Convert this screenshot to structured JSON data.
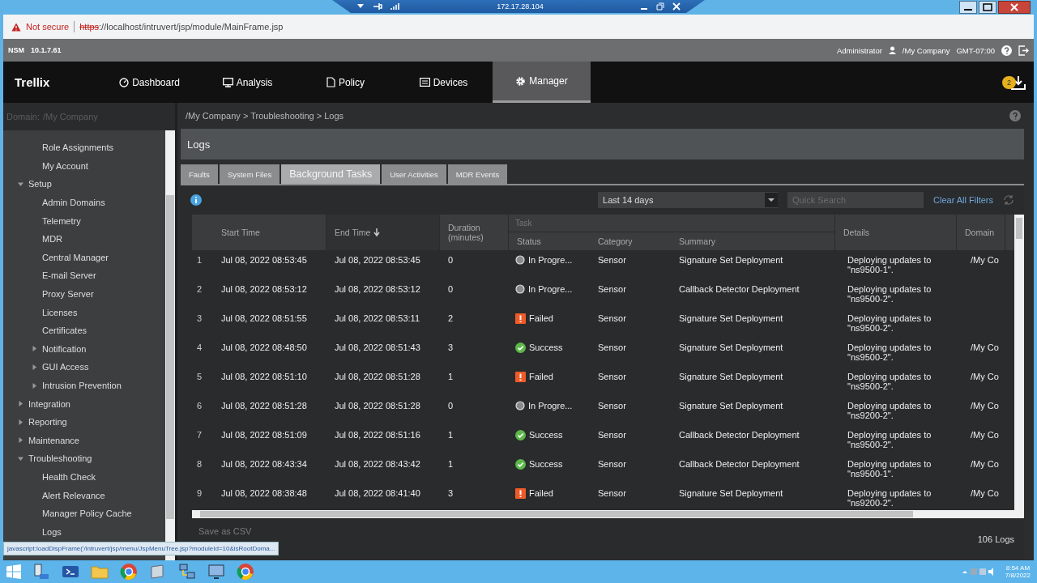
{
  "remote_bar": {
    "host": "172.17.28.104"
  },
  "browser": {
    "security": "Not secure",
    "url_scheme": "https",
    "url_rest": "://localhost/intruvert/jsp/module/MainFrame.jsp"
  },
  "header": {
    "product": "NSM",
    "version": "10.1.7.61",
    "user": "Administrator",
    "domain": "/My Company",
    "timezone": "GMT-07:00"
  },
  "nav": {
    "logo": "Trellix",
    "tabs": [
      {
        "label": "Dashboard",
        "selected": false
      },
      {
        "label": "Analysis",
        "selected": false
      },
      {
        "label": "Policy",
        "selected": false
      },
      {
        "label": "Devices",
        "selected": false
      },
      {
        "label": "Manager",
        "selected": true
      }
    ],
    "downloads_badge": "2"
  },
  "sidebar": {
    "domain_label": "Domain:",
    "domain_value": "/My Company",
    "items": [
      {
        "children": [
          {
            "label": "Role Assignments"
          },
          {
            "label": "My Account"
          }
        ]
      },
      {
        "label": "Setup",
        "expanded": true,
        "children": [
          {
            "label": "Admin Domains"
          },
          {
            "label": "Telemetry"
          },
          {
            "label": "MDR"
          },
          {
            "label": "Central Manager"
          },
          {
            "label": "E-mail Server"
          },
          {
            "label": "Proxy Server"
          },
          {
            "label": "Licenses"
          },
          {
            "label": "Certificates"
          },
          {
            "label": "Notification",
            "expanded": false
          },
          {
            "label": "GUI Access",
            "expanded": false
          },
          {
            "label": "Intrusion Prevention",
            "expanded": false
          }
        ]
      },
      {
        "label": "Integration",
        "expanded": false
      },
      {
        "label": "Reporting",
        "expanded": false
      },
      {
        "label": "Maintenance",
        "expanded": false
      },
      {
        "label": "Troubleshooting",
        "expanded": true,
        "children": [
          {
            "label": "Health Check"
          },
          {
            "label": "Alert Relevance"
          },
          {
            "label": "Manager Policy Cache"
          },
          {
            "label": "Logs"
          }
        ]
      }
    ]
  },
  "breadcrumb": "/My Company > Troubleshooting > Logs",
  "page_title": "Logs",
  "tabs": [
    {
      "label": "Faults",
      "selected": false
    },
    {
      "label": "System Files",
      "selected": false
    },
    {
      "label": "Background Tasks",
      "selected": true
    },
    {
      "label": "User Activities",
      "selected": false
    },
    {
      "label": "MDR Events",
      "selected": false
    }
  ],
  "filters": {
    "range": "Last 14 days",
    "search_placeholder": "Quick Search",
    "clear": "Clear All Filters"
  },
  "table": {
    "columns": [
      {
        "label": "Start Time",
        "sorted": false
      },
      {
        "label": "End Time",
        "sorted": true
      },
      {
        "label": "Duration (minutes)",
        "sorted": false
      }
    ],
    "task_group": {
      "label": "Task",
      "columns": [
        "Status",
        "Category",
        "Summary"
      ]
    },
    "columns_after": [
      "Details",
      "Domain"
    ],
    "rows": [
      {
        "index": "1",
        "start": "Jul 08, 2022 08:53:45",
        "end": "Jul 08, 2022 08:53:45",
        "duration": "0",
        "status": {
          "kind": "in_progress",
          "label": "In Progre..."
        },
        "category": "Sensor",
        "summary": "Signature Set Deployment",
        "details": "Deploying updates to \"ns9500-1\".",
        "domain": "/My Co"
      },
      {
        "index": "2",
        "start": "Jul 08, 2022 08:53:12",
        "end": "Jul 08, 2022 08:53:12",
        "duration": "0",
        "status": {
          "kind": "in_progress",
          "label": "In Progre..."
        },
        "category": "Sensor",
        "summary": "Callback Detector Deployment",
        "details": "Deploying updates to \"ns9500-2\"."
      },
      {
        "index": "3",
        "start": "Jul 08, 2022 08:51:55",
        "end": "Jul 08, 2022 08:53:11",
        "duration": "2",
        "status": {
          "kind": "failed",
          "label": "Failed"
        },
        "category": "Sensor",
        "summary": "Signature Set Deployment",
        "details": "Deploying updates to \"ns9500-2\"."
      },
      {
        "index": "4",
        "start": "Jul 08, 2022 08:48:50",
        "end": "Jul 08, 2022 08:51:43",
        "duration": "3",
        "status": {
          "kind": "success",
          "label": "Success"
        },
        "category": "Sensor",
        "summary": "Signature Set Deployment",
        "details": "Deploying updates to \"ns9500-2\".",
        "domain": "/My Co"
      },
      {
        "index": "5",
        "start": "Jul 08, 2022 08:51:10",
        "end": "Jul 08, 2022 08:51:28",
        "duration": "1",
        "status": {
          "kind": "failed",
          "label": "Failed"
        },
        "category": "Sensor",
        "summary": "Signature Set Deployment",
        "details": "Deploying updates to \"ns9500-2\".",
        "domain": "/My Co"
      },
      {
        "index": "6",
        "start": "Jul 08, 2022 08:51:28",
        "end": "Jul 08, 2022 08:51:28",
        "duration": "0",
        "status": {
          "kind": "in_progress",
          "label": "In Progre..."
        },
        "category": "Sensor",
        "summary": "Signature Set Deployment",
        "details": "Deploying updates to \"ns9200-2\".",
        "domain": "/My Co"
      },
      {
        "index": "7",
        "start": "Jul 08, 2022 08:51:09",
        "end": "Jul 08, 2022 08:51:16",
        "duration": "1",
        "status": {
          "kind": "success",
          "label": "Success"
        },
        "category": "Sensor",
        "summary": "Callback Detector Deployment",
        "details": "Deploying updates to \"ns9500-2\".",
        "domain": "/My Co"
      },
      {
        "index": "8",
        "start": "Jul 08, 2022 08:43:34",
        "end": "Jul 08, 2022 08:43:42",
        "duration": "1",
        "status": {
          "kind": "success",
          "label": "Success"
        },
        "category": "Sensor",
        "summary": "Callback Detector Deployment",
        "details": "Deploying updates to \"ns9500-1\".",
        "domain": "/My Co"
      },
      {
        "index": "9",
        "start": "Jul 08, 2022 08:38:48",
        "end": "Jul 08, 2022 08:41:40",
        "duration": "3",
        "status": {
          "kind": "failed",
          "label": "Failed"
        },
        "category": "Sensor",
        "summary": "Signature Set Deployment",
        "details": "Deploying updates to \"ns9200-2\".",
        "domain": "/My Co"
      }
    ]
  },
  "footer": {
    "save": "Save as CSV",
    "count": "106 Logs"
  },
  "status_link": "javascript:loadDispFrame('/intruvert/jsp/menu/JspMenuTree.jsp?moduleId=10&isRootDoma...",
  "taskbar": {
    "time": "8:54 AM",
    "date": "7/8/2022"
  }
}
